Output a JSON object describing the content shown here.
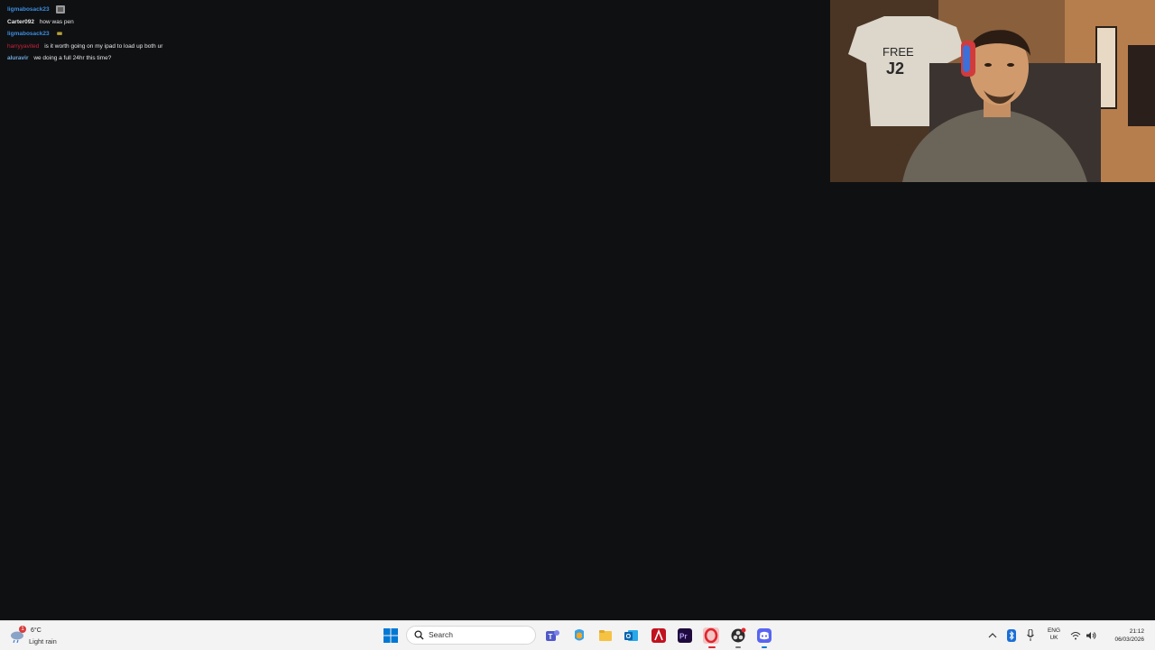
{
  "chat": {
    "messages": [
      {
        "user": "ligmabosack23",
        "text": "",
        "user_color": "#3b8de0",
        "badge": "emote-icon"
      },
      {
        "user": "Carter092",
        "text": "how was pen",
        "user_color": "#e6e6e6"
      },
      {
        "user": "ligmabosack23",
        "text": "",
        "user_color": "#3b8de0",
        "badge": "emote-small-icon"
      },
      {
        "user": "harryyavited",
        "text": "is it worth going on my ipad to load up both ur",
        "user_color": "#c8233b"
      },
      {
        "user": "aluravir",
        "text": "we doing a full 24hr this time?",
        "user_color": "#6fa8dc"
      }
    ]
  },
  "webcam": {
    "shirt_text": "FREE J2"
  },
  "taskbar": {
    "weather_temp": "6°C",
    "weather_condition": "Light rain",
    "weather_alert_count": "1",
    "search_placeholder": "Search",
    "language_line1": "ENG",
    "language_line2": "UK",
    "time": "21:12",
    "date": "06/03/2026",
    "apps": [
      "teams-icon",
      "copilot-icon",
      "file-explorer-icon",
      "outlook-icon",
      "affinity-icon",
      "premiere-pro-icon",
      "opera-gx-icon",
      "obs-icon",
      "discord-icon"
    ]
  },
  "colors": {
    "background": "#0f1012",
    "taskbar": "#f3f3f3",
    "accent_blue": "#0078d4"
  }
}
